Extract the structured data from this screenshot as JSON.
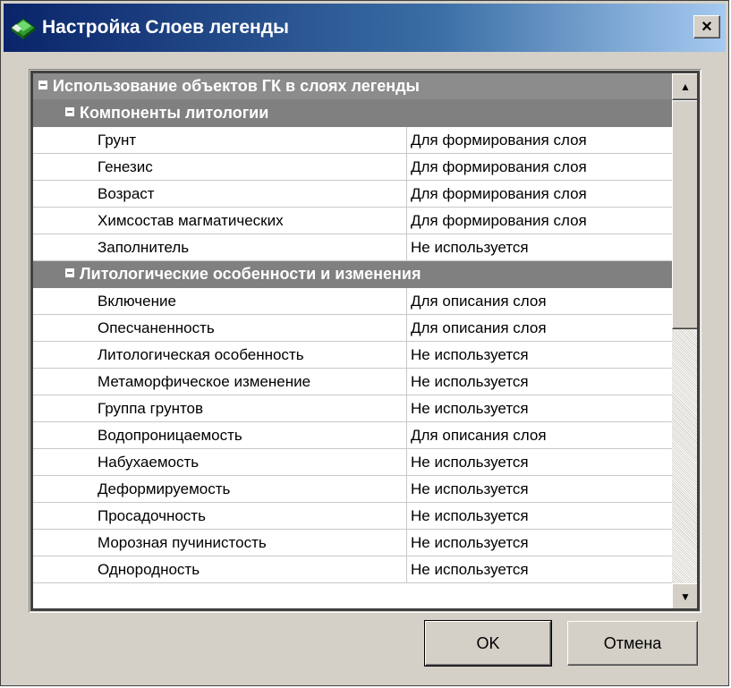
{
  "window": {
    "title": "Настройка Слоев легенды",
    "close_label": "×"
  },
  "colors": {
    "title_bar": "#0a246a",
    "category_header": "#808080",
    "dialog_bg": "#d4d0c8"
  },
  "grid": {
    "root": {
      "label": "Использование объектов ГК в слоях легенды"
    },
    "groups": [
      {
        "label": "Компоненты литологии",
        "rows": [
          {
            "name": "Грунт",
            "value": "Для формирования слоя"
          },
          {
            "name": "Генезис",
            "value": "Для формирования слоя"
          },
          {
            "name": "Возраст",
            "value": "Для формирования слоя"
          },
          {
            "name": "Химсостав магматических",
            "value": "Для формирования слоя"
          },
          {
            "name": "Заполнитель",
            "value": "Не используется"
          }
        ]
      },
      {
        "label": "Литологические особенности и изменения",
        "rows": [
          {
            "name": "Включение",
            "value": "Для описания слоя"
          },
          {
            "name": "Опесчаненность",
            "value": "Для описания слоя"
          },
          {
            "name": "Литологическая особенность",
            "value": "Не используется"
          },
          {
            "name": "Метаморфическое изменение",
            "value": "Не используется"
          },
          {
            "name": "Группа грунтов",
            "value": "Не используется"
          },
          {
            "name": "Водопроницаемость",
            "value": "Для описания слоя"
          },
          {
            "name": "Набухаемость",
            "value": "Не используется"
          },
          {
            "name": "Деформируемость",
            "value": "Не используется"
          },
          {
            "name": "Просадочность",
            "value": "Не используется"
          },
          {
            "name": "Морозная пучинистость",
            "value": "Не используется"
          },
          {
            "name": "Однородность",
            "value": "Не используется"
          }
        ]
      }
    ]
  },
  "scrollbar": {
    "up_icon": "scroll-up-arrow-icon",
    "down_icon": "scroll-down-arrow-icon"
  },
  "buttons": {
    "ok_label": "OK",
    "cancel_label": "Отмена"
  }
}
